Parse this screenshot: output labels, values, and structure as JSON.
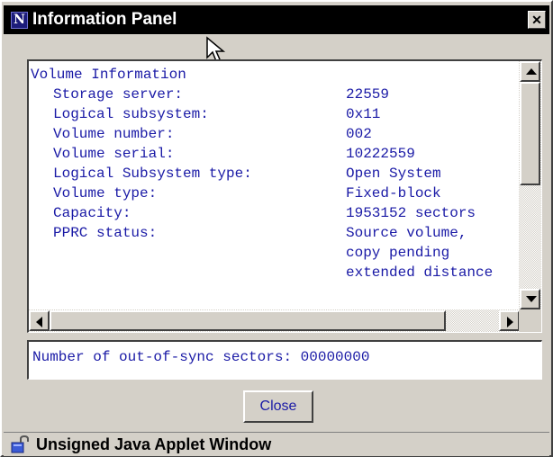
{
  "window": {
    "title": "Information Panel",
    "app_icon_letter": "N",
    "close_glyph": "✕"
  },
  "info": {
    "heading": "Volume Information",
    "rows": [
      {
        "label": "Storage server:",
        "value": "22559"
      },
      {
        "label": "Logical subsystem:",
        "value": "0x11"
      },
      {
        "label": "Volume number:",
        "value": "002"
      },
      {
        "label": "Volume serial:",
        "value": "10222559"
      },
      {
        "label": "Logical Subsystem type:",
        "value": "Open System"
      },
      {
        "label": "Volume type:",
        "value": "Fixed-block"
      },
      {
        "label": "Capacity:",
        "value": "1953152 sectors"
      },
      {
        "label": "PPRC status:",
        "value": "Source volume,"
      },
      {
        "label": "",
        "value": "copy pending"
      },
      {
        "label": "",
        "value": "extended distance"
      }
    ]
  },
  "status_field": {
    "text": "Number of out-of-sync sectors: 00000000"
  },
  "buttons": {
    "close_label": "Close"
  },
  "applet_bar": {
    "text": "Unsigned Java Applet Window"
  },
  "icons": [
    "app-icon",
    "close-icon",
    "mouse-pointer-icon",
    "scroll-up-icon",
    "scroll-down-icon",
    "scroll-left-icon",
    "scroll-right-icon",
    "unlock-icon"
  ],
  "colors": {
    "text": "#1a1aa6",
    "title_bar": "#000000",
    "face": "#d4d0c8"
  }
}
